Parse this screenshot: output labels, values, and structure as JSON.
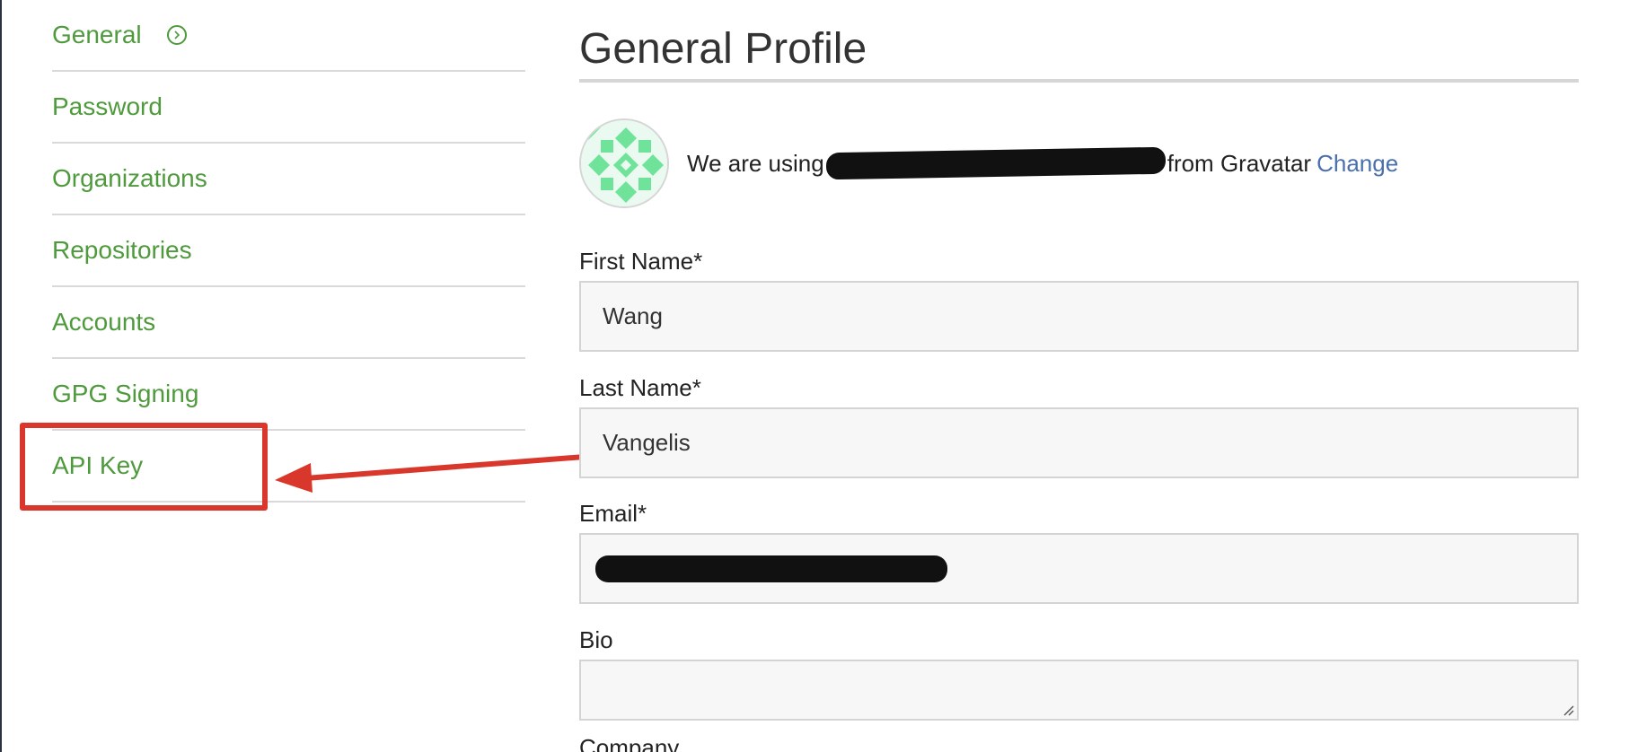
{
  "sidebar": {
    "items": [
      {
        "label": "General"
      },
      {
        "label": "Password"
      },
      {
        "label": "Organizations"
      },
      {
        "label": "Repositories"
      },
      {
        "label": "Accounts"
      },
      {
        "label": "GPG Signing"
      },
      {
        "label": "API Key"
      }
    ]
  },
  "main": {
    "title": "General Profile",
    "avatar": {
      "prefix": "We are using",
      "suffix": "from Gravatar",
      "change_link": "Change"
    },
    "fields": {
      "first_name": {
        "label": "First Name*",
        "value": "Wang"
      },
      "last_name": {
        "label": "Last Name*",
        "value": "Vangelis"
      },
      "email": {
        "label": "Email*"
      },
      "bio": {
        "label": "Bio"
      },
      "company": {
        "label": "Company"
      }
    }
  },
  "colors": {
    "link_green": "#4e9a3d",
    "link_blue": "#4a6fae",
    "annotation_red": "#d9372b"
  }
}
